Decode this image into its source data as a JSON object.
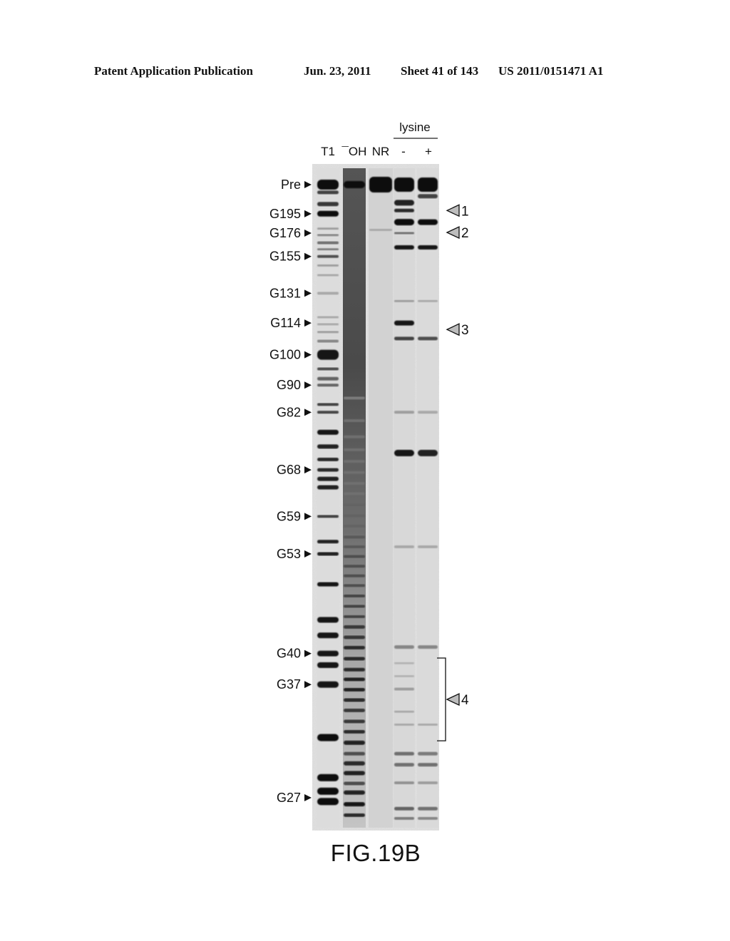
{
  "header": {
    "publication": "Patent Application Publication",
    "date": "Jun. 23, 2011",
    "sheet": "Sheet 41 of 143",
    "number": "US 2011/0151471 A1"
  },
  "figure": {
    "caption": "FIG.19B",
    "group_label": "lysine",
    "lanes": [
      {
        "id": "T1",
        "label": "T1"
      },
      {
        "id": "OH",
        "label": "¯OH"
      },
      {
        "id": "NR",
        "label": "NR"
      },
      {
        "id": "minus",
        "label": "-"
      },
      {
        "id": "plus",
        "label": "+"
      }
    ],
    "markers": [
      {
        "label": "Pre",
        "pos": 0.0
      },
      {
        "label": "G195",
        "pos": 0.045
      },
      {
        "label": "G176",
        "pos": 0.075
      },
      {
        "label": "G155",
        "pos": 0.111
      },
      {
        "label": "G131",
        "pos": 0.168
      },
      {
        "label": "G114",
        "pos": 0.214
      },
      {
        "label": "G100",
        "pos": 0.263
      },
      {
        "label": "G90",
        "pos": 0.31
      },
      {
        "label": "G82",
        "pos": 0.352
      },
      {
        "label": "G68",
        "pos": 0.441
      },
      {
        "label": "G59",
        "pos": 0.513
      },
      {
        "label": "G53",
        "pos": 0.571
      },
      {
        "label": "G40",
        "pos": 0.725
      },
      {
        "label": "G37",
        "pos": 0.773
      },
      {
        "label": "G27",
        "pos": 0.948
      }
    ],
    "annotations": [
      {
        "label": "1",
        "pos": 0.04
      },
      {
        "label": "2",
        "pos": 0.074
      },
      {
        "label": "3",
        "pos": 0.224
      },
      {
        "label": "4",
        "pos": 0.796,
        "bracket": [
          0.732,
          0.86
        ]
      }
    ],
    "bands": {
      "T1": [
        [
          0.0,
          1.0,
          14
        ],
        [
          0.012,
          0.75,
          5
        ],
        [
          0.03,
          0.8,
          6
        ],
        [
          0.045,
          1.0,
          8
        ],
        [
          0.068,
          0.35,
          3
        ],
        [
          0.078,
          0.45,
          3
        ],
        [
          0.09,
          0.55,
          4
        ],
        [
          0.1,
          0.5,
          3
        ],
        [
          0.111,
          0.7,
          4
        ],
        [
          0.125,
          0.35,
          3
        ],
        [
          0.14,
          0.3,
          3
        ],
        [
          0.168,
          0.3,
          4
        ],
        [
          0.205,
          0.3,
          3
        ],
        [
          0.216,
          0.3,
          3
        ],
        [
          0.228,
          0.35,
          3
        ],
        [
          0.242,
          0.45,
          4
        ],
        [
          0.263,
          0.95,
          14
        ],
        [
          0.285,
          0.7,
          4
        ],
        [
          0.3,
          0.6,
          5
        ],
        [
          0.31,
          0.6,
          4
        ],
        [
          0.34,
          0.75,
          4
        ],
        [
          0.352,
          0.75,
          4
        ],
        [
          0.383,
          0.95,
          7
        ],
        [
          0.405,
          0.9,
          6
        ],
        [
          0.425,
          0.85,
          5
        ],
        [
          0.441,
          0.85,
          5
        ],
        [
          0.455,
          0.9,
          6
        ],
        [
          0.468,
          0.9,
          6
        ],
        [
          0.513,
          0.75,
          4
        ],
        [
          0.552,
          0.9,
          5
        ],
        [
          0.571,
          0.9,
          5
        ],
        [
          0.618,
          0.95,
          6
        ],
        [
          0.673,
          0.95,
          8
        ],
        [
          0.697,
          0.95,
          8
        ],
        [
          0.725,
          0.95,
          8
        ],
        [
          0.743,
          0.95,
          8
        ],
        [
          0.773,
          0.95,
          9
        ],
        [
          0.855,
          1.0,
          10
        ],
        [
          0.917,
          1.0,
          10
        ],
        [
          0.938,
          1.0,
          10
        ],
        [
          0.954,
          1.0,
          10
        ]
      ],
      "OH": [
        [
          0.0,
          1.0,
          10
        ],
        [
          0.33,
          0.5,
          4
        ],
        [
          0.365,
          0.55,
          4
        ],
        [
          0.39,
          0.55,
          4
        ],
        [
          0.41,
          0.55,
          4
        ],
        [
          0.428,
          0.55,
          4
        ],
        [
          0.445,
          0.55,
          4
        ],
        [
          0.462,
          0.55,
          4
        ],
        [
          0.478,
          0.55,
          4
        ],
        [
          0.495,
          0.6,
          4
        ],
        [
          0.512,
          0.6,
          4
        ],
        [
          0.528,
          0.6,
          4
        ],
        [
          0.545,
          0.65,
          4
        ],
        [
          0.56,
          0.65,
          4
        ],
        [
          0.575,
          0.7,
          4
        ],
        [
          0.59,
          0.7,
          4
        ],
        [
          0.605,
          0.7,
          4
        ],
        [
          0.62,
          0.7,
          4
        ],
        [
          0.636,
          0.75,
          4
        ],
        [
          0.652,
          0.75,
          4
        ],
        [
          0.668,
          0.75,
          4
        ],
        [
          0.684,
          0.8,
          5
        ],
        [
          0.7,
          0.8,
          5
        ],
        [
          0.716,
          0.85,
          5
        ],
        [
          0.733,
          0.85,
          5
        ],
        [
          0.75,
          0.85,
          5
        ],
        [
          0.765,
          0.9,
          5
        ],
        [
          0.781,
          0.9,
          5
        ],
        [
          0.797,
          0.85,
          5
        ],
        [
          0.813,
          0.8,
          5
        ],
        [
          0.83,
          0.8,
          5
        ],
        [
          0.846,
          0.85,
          5
        ],
        [
          0.863,
          0.9,
          6
        ],
        [
          0.88,
          0.7,
          5
        ],
        [
          0.895,
          0.85,
          6
        ],
        [
          0.91,
          0.9,
          6
        ],
        [
          0.926,
          0.7,
          5
        ],
        [
          0.94,
          0.9,
          6
        ],
        [
          0.958,
          0.95,
          6
        ],
        [
          0.975,
          0.85,
          5
        ]
      ],
      "NR": [
        [
          0.0,
          1.0,
          22
        ],
        [
          0.07,
          0.3,
          3
        ]
      ],
      "minus": [
        [
          0.0,
          1.0,
          20
        ],
        [
          0.028,
          0.9,
          8
        ],
        [
          0.04,
          0.85,
          5
        ],
        [
          0.058,
          1.0,
          9
        ],
        [
          0.075,
          0.55,
          3
        ],
        [
          0.097,
          0.95,
          6
        ],
        [
          0.18,
          0.35,
          3
        ],
        [
          0.214,
          0.95,
          7
        ],
        [
          0.238,
          0.75,
          5
        ],
        [
          0.352,
          0.35,
          4
        ],
        [
          0.415,
          0.95,
          9
        ],
        [
          0.56,
          0.3,
          4
        ],
        [
          0.715,
          0.45,
          5
        ],
        [
          0.74,
          0.25,
          3
        ],
        [
          0.76,
          0.25,
          3
        ],
        [
          0.78,
          0.35,
          4
        ],
        [
          0.815,
          0.3,
          3
        ],
        [
          0.835,
          0.3,
          3
        ],
        [
          0.88,
          0.55,
          5
        ],
        [
          0.897,
          0.55,
          5
        ],
        [
          0.925,
          0.4,
          4
        ],
        [
          0.965,
          0.6,
          5
        ],
        [
          0.98,
          0.5,
          4
        ]
      ],
      "plus": [
        [
          0.0,
          1.0,
          20
        ],
        [
          0.018,
          0.75,
          6
        ],
        [
          0.058,
          1.0,
          8
        ],
        [
          0.097,
          0.95,
          6
        ],
        [
          0.18,
          0.3,
          3
        ],
        [
          0.238,
          0.7,
          5
        ],
        [
          0.352,
          0.3,
          4
        ],
        [
          0.415,
          0.9,
          9
        ],
        [
          0.56,
          0.3,
          4
        ],
        [
          0.715,
          0.45,
          5
        ],
        [
          0.835,
          0.3,
          3
        ],
        [
          0.88,
          0.5,
          5
        ],
        [
          0.897,
          0.55,
          5
        ],
        [
          0.925,
          0.35,
          4
        ],
        [
          0.965,
          0.55,
          5
        ],
        [
          0.98,
          0.45,
          4
        ]
      ]
    }
  }
}
